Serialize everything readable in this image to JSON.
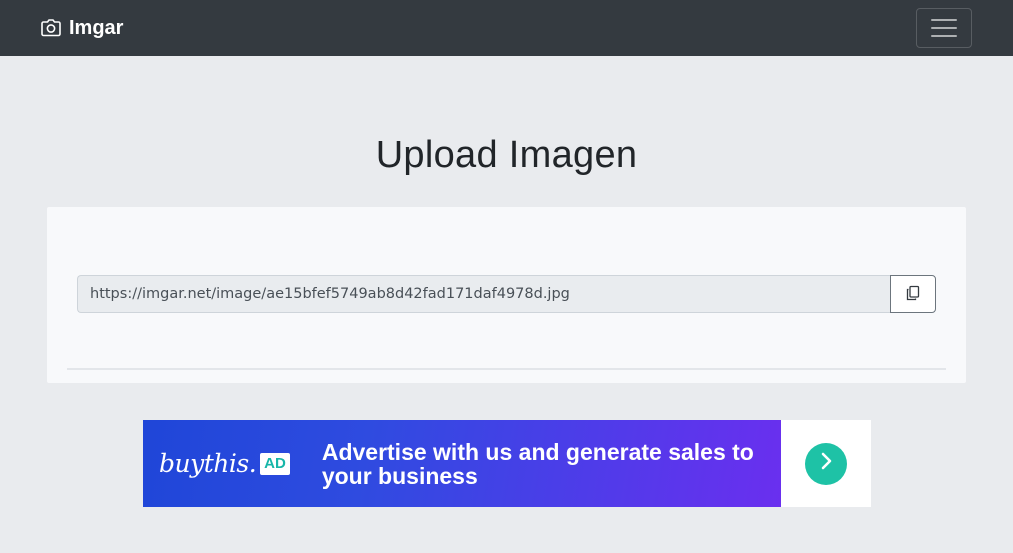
{
  "navbar": {
    "brand_label": "Imgar",
    "brand_icon": "camera-icon",
    "menu_icon": "hamburger-menu-icon",
    "background": "#343a40"
  },
  "main": {
    "title": "Upload Imagen",
    "url_value": "https://imgar.net/image/ae15bfef5749ab8d42fad171daf4978d.jpg",
    "copy_icon": "copy-clipboard-icon"
  },
  "ad": {
    "logo_text": "buythis.",
    "logo_badge": "AD",
    "headline": "Advertise with us and generate sales to your business",
    "arrow_icon": "chevron-right-icon",
    "accent_color": "#1ec2a6"
  }
}
